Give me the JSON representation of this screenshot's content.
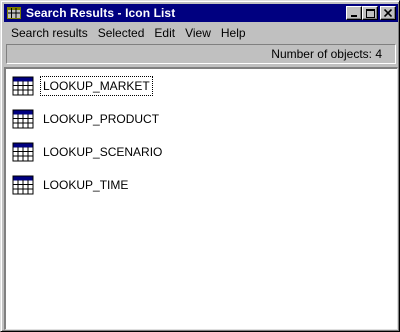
{
  "window": {
    "title": "Search Results - Icon List",
    "title_icon": "table-grid-icon",
    "controls": [
      "minimize-icon",
      "maximize-icon",
      "close-icon"
    ]
  },
  "menu": [
    "Search results",
    "Selected",
    "Edit",
    "View",
    "Help"
  ],
  "status": {
    "object_count_text": "Number of objects: 4"
  },
  "items": [
    {
      "label": "LOOKUP_MARKET",
      "icon": "table-icon",
      "focused": true
    },
    {
      "label": "LOOKUP_PRODUCT",
      "icon": "table-icon",
      "focused": false
    },
    {
      "label": "LOOKUP_SCENARIO",
      "icon": "table-icon",
      "focused": false
    },
    {
      "label": "LOOKUP_TIME",
      "icon": "table-icon",
      "focused": false
    }
  ],
  "colors": {
    "titlebar": "#000080",
    "face": "#c0c0c0",
    "table_header": "#000080",
    "table_cell": "#ffffff"
  }
}
